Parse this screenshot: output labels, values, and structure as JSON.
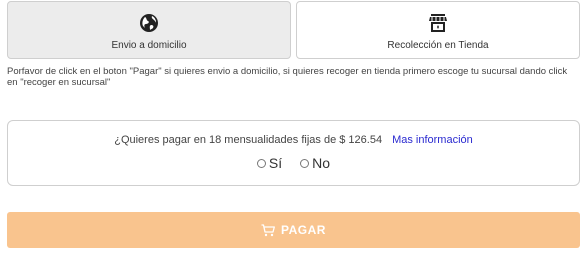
{
  "delivery": {
    "home": {
      "label": "Envio a domicilio",
      "icon": "globe-icon"
    },
    "pickup": {
      "label": "Recolección en Tienda",
      "icon": "store-icon"
    }
  },
  "hint": "Porfavor de click en el boton \"Pagar\" si quieres envio a domicilio, si quieres recoger en tienda primero escoge tu sucursal dando click en \"recoger en sucursal\"",
  "installments": {
    "question": "¿Quieres pagar en 18 mensualidades fijas de $ 126.54",
    "more_info": "Mas información",
    "options": [
      "Sí",
      "No"
    ]
  },
  "pay_button": {
    "label": "PAGAR",
    "icon": "cart-icon",
    "color": "#f9c48e"
  }
}
